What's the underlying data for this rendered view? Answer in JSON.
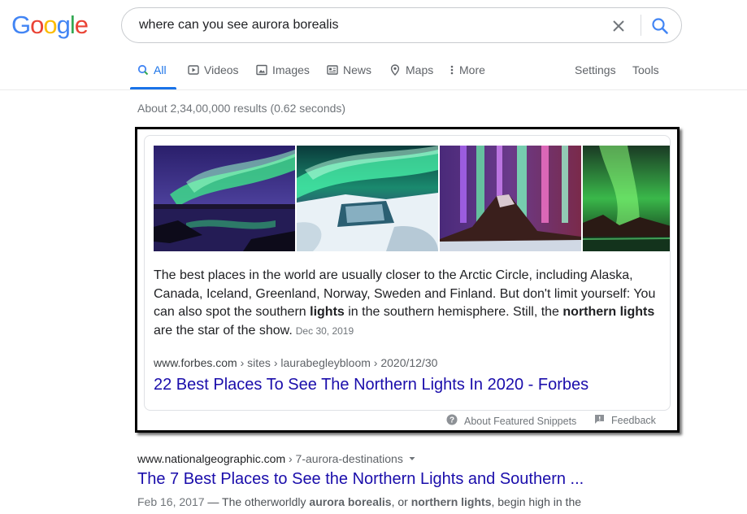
{
  "logo": {
    "letters": [
      "G",
      "o",
      "o",
      "g",
      "l",
      "e"
    ],
    "colors": [
      "#4285F4",
      "#EA4335",
      "#FBBC05",
      "#4285F4",
      "#34A853",
      "#EA4335"
    ]
  },
  "search": {
    "query": "where can you see aurora borealis"
  },
  "tabs": [
    {
      "label": "All",
      "icon": "search-icon",
      "active": true
    },
    {
      "label": "Videos",
      "icon": "video-icon"
    },
    {
      "label": "Images",
      "icon": "image-icon"
    },
    {
      "label": "News",
      "icon": "news-icon"
    },
    {
      "label": "Maps",
      "icon": "map-pin-icon"
    },
    {
      "label": "More",
      "icon": "more-vert-icon"
    }
  ],
  "tools": {
    "settings": "Settings",
    "tools": "Tools"
  },
  "stats": "About 2,34,00,000 results (0.62 seconds)",
  "snippet": {
    "images": [
      "aurora-lake-image",
      "aurora-waterfall-image",
      "aurora-mountain-image",
      "aurora-green-image"
    ],
    "text_parts": [
      "The best places in the world are usually closer to the Arctic Circle, including Alaska, Canada, Iceland, Greenland, Norway, Sweden and Finland. But don't limit yourself: You can also spot the southern ",
      "lights",
      " in the southern hemisphere. Still, the ",
      "northern lights",
      " are the star of the show."
    ],
    "date": "Dec 30, 2019",
    "cite_domain": "www.forbes.com",
    "cite_path": " › sites › laurabegleybloom › 2020/12/30",
    "title": "22 Best Places To See The Northern Lights In 2020 - Forbes",
    "about_label": "About Featured Snippets",
    "feedback_label": "Feedback"
  },
  "result2": {
    "cite_domain": "www.nationalgeographic.com",
    "cite_path": " › 7-aurora-destinations",
    "title": "The 7 Best Places to See the Northern Lights and Southern ...",
    "date": "Feb 16, 2017",
    "snippet_parts": [
      " — The otherworldly ",
      "aurora borealis",
      ", or ",
      "northern lights",
      ", begin high in the"
    ]
  },
  "colors": {
    "accent": "#1a73e8",
    "link": "#1a0dab"
  }
}
